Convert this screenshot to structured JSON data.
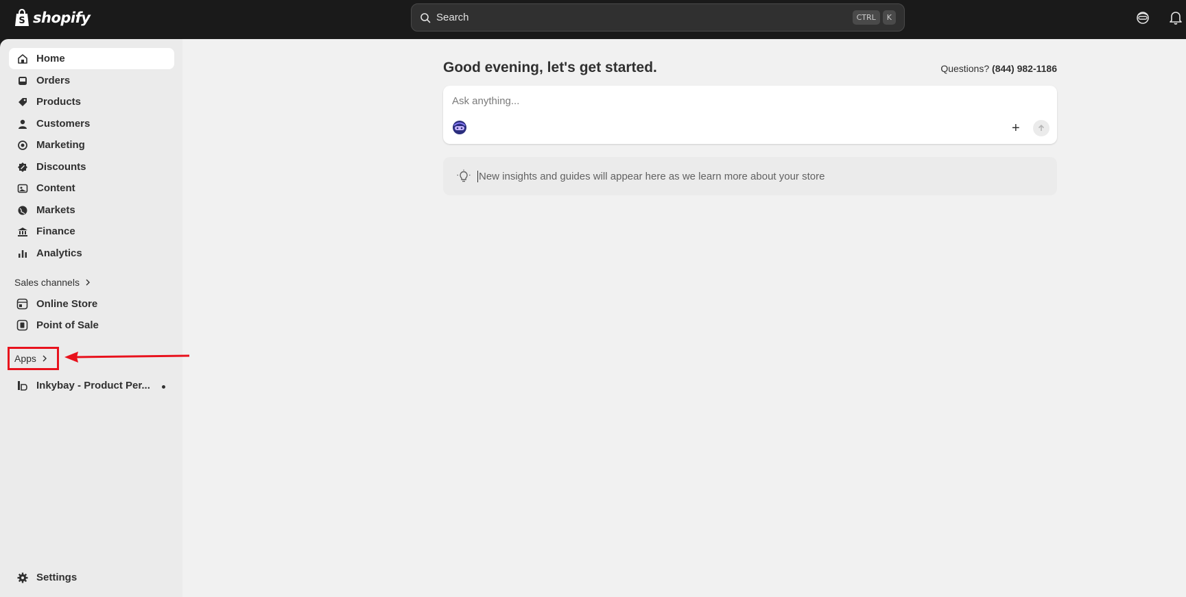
{
  "brand": {
    "name": "shopify"
  },
  "search": {
    "label": "Search",
    "shortcut_keys": [
      "CTRL",
      "K"
    ]
  },
  "sidebar": {
    "items": [
      {
        "label": "Home",
        "icon": "home-icon",
        "active": true
      },
      {
        "label": "Orders",
        "icon": "inbox-icon"
      },
      {
        "label": "Products",
        "icon": "tag-icon"
      },
      {
        "label": "Customers",
        "icon": "person-icon"
      },
      {
        "label": "Marketing",
        "icon": "target-icon"
      },
      {
        "label": "Discounts",
        "icon": "discount-icon"
      },
      {
        "label": "Content",
        "icon": "image-icon"
      },
      {
        "label": "Markets",
        "icon": "globe-icon"
      },
      {
        "label": "Finance",
        "icon": "bank-icon"
      },
      {
        "label": "Analytics",
        "icon": "bar-chart-icon"
      }
    ],
    "sales_channels_label": "Sales channels",
    "sales_channels": [
      {
        "label": "Online Store",
        "icon": "store-icon"
      },
      {
        "label": "Point of Sale",
        "icon": "pos-icon"
      }
    ],
    "apps_label": "Apps",
    "apps": [
      {
        "label": "Inkybay - Product Per...",
        "icon": "inkybay-icon"
      }
    ],
    "settings_label": "Settings"
  },
  "main": {
    "greeting": "Good evening, let's get started.",
    "questions_label": "Questions?",
    "phone": "(844) 982-1186",
    "ask_placeholder": "Ask anything...",
    "insights_text": "New insights and guides will appear here as we learn more about your store"
  },
  "annotation": {
    "color": "#e8111c"
  }
}
